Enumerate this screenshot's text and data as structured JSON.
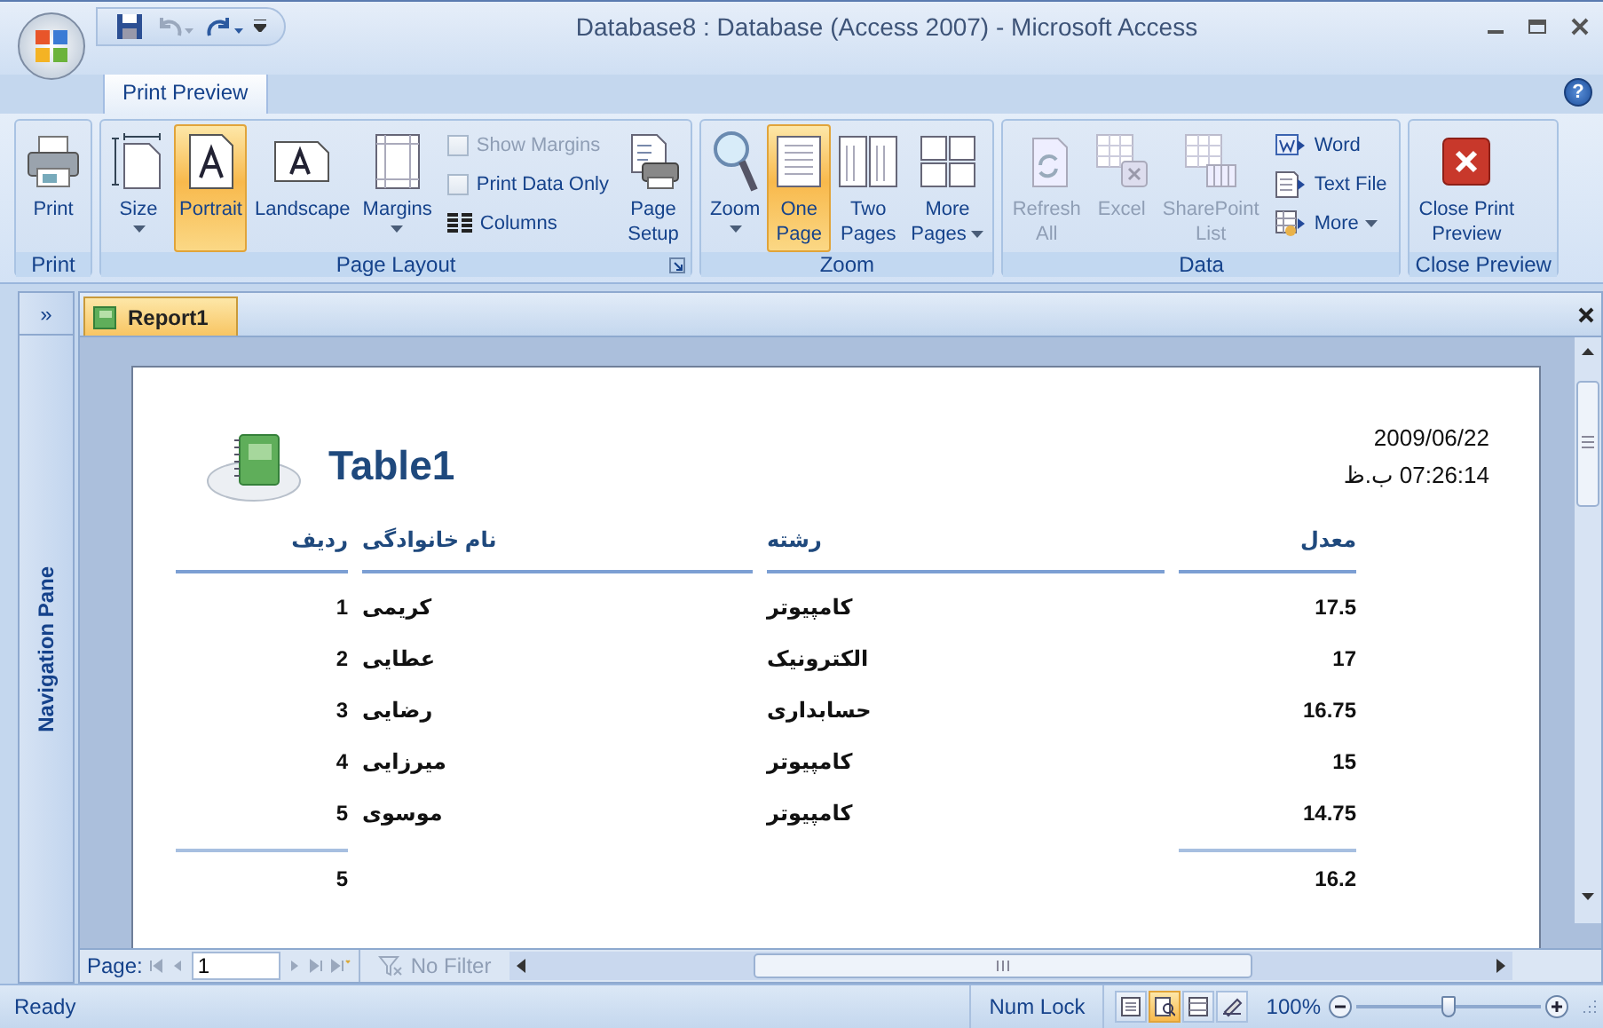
{
  "window": {
    "title": "Database8 : Database (Access 2007) - Microsoft Access"
  },
  "ribbon_tabs": [
    {
      "label": "Print Preview",
      "selected": true
    }
  ],
  "help_button": "?",
  "ribbon_groups": [
    {
      "label": "Print",
      "items": [
        {
          "kind": "large",
          "label": "Print",
          "selected": false,
          "disabled": false,
          "dropdown": false
        }
      ]
    },
    {
      "label": "Page Layout",
      "launcher": true,
      "items": [
        {
          "kind": "large",
          "label": "Size",
          "selected": false,
          "disabled": false,
          "dropdown": true
        },
        {
          "kind": "large",
          "label": "Portrait",
          "selected": true,
          "disabled": false,
          "dropdown": false
        },
        {
          "kind": "large",
          "label": "Landscape",
          "selected": false,
          "disabled": false,
          "dropdown": false
        },
        {
          "kind": "large",
          "label": "Margins",
          "selected": false,
          "disabled": false,
          "dropdown": true
        },
        {
          "kind": "checkbox",
          "label": "Show Margins",
          "checked": false,
          "selected": false,
          "disabled": true,
          "dropdown": false
        },
        {
          "kind": "checkbox",
          "label": "Print Data Only",
          "checked": false,
          "selected": false,
          "disabled": false,
          "dropdown": false
        },
        {
          "kind": "small",
          "label": "Columns",
          "selected": false,
          "disabled": false,
          "dropdown": false
        },
        {
          "kind": "large",
          "label": "Page\nSetup",
          "selected": false,
          "disabled": false,
          "dropdown": false
        }
      ]
    },
    {
      "label": "Zoom",
      "items": [
        {
          "kind": "large",
          "label": "Zoom",
          "selected": false,
          "disabled": false,
          "dropdown": true
        },
        {
          "kind": "large",
          "label": "One\nPage",
          "selected": true,
          "disabled": false,
          "dropdown": false
        },
        {
          "kind": "large",
          "label": "Two\nPages",
          "selected": false,
          "disabled": false,
          "dropdown": false
        },
        {
          "kind": "large",
          "label": "More\nPages",
          "selected": false,
          "disabled": false,
          "dropdown": true
        }
      ]
    },
    {
      "label": "Data",
      "items": [
        {
          "kind": "large",
          "label": "Refresh\nAll",
          "selected": false,
          "disabled": true,
          "dropdown": false
        },
        {
          "kind": "large",
          "label": "Excel",
          "selected": false,
          "disabled": true,
          "dropdown": false
        },
        {
          "kind": "large",
          "label": "SharePoint\nList",
          "selected": false,
          "disabled": true,
          "dropdown": false
        },
        {
          "kind": "small",
          "label": "Word",
          "selected": false,
          "disabled": false,
          "dropdown": false
        },
        {
          "kind": "small",
          "label": "Text File",
          "selected": false,
          "disabled": false,
          "dropdown": false
        },
        {
          "kind": "small",
          "label": "More",
          "selected": false,
          "disabled": false,
          "dropdown": true
        }
      ]
    },
    {
      "label": "Close Preview",
      "items": [
        {
          "kind": "large",
          "label": "Close Print\nPreview",
          "selected": false,
          "disabled": false,
          "dropdown": false
        }
      ]
    }
  ],
  "navigation_pane": {
    "toggle": "»",
    "label": "Navigation Pane"
  },
  "document_tabs": [
    {
      "label": "Report1",
      "selected": true
    }
  ],
  "report": {
    "title": "Table1",
    "date": "2009/06/22",
    "time": "07:26:14 ب.ظ",
    "columns": [
      "ردیف",
      "نام خانوادگی",
      "رشته",
      "معدل"
    ],
    "rows": [
      [
        "1",
        "کریمی",
        "کامپیوتر",
        "17.5"
      ],
      [
        "2",
        "عطایی",
        "الکترونیک",
        "17"
      ],
      [
        "3",
        "رضایی",
        "حسابداری",
        "16.75"
      ],
      [
        "4",
        "میرزایی",
        "کامپیوتر",
        "15"
      ],
      [
        "5",
        "موسوی",
        "کامپیوتر",
        "14.75"
      ]
    ],
    "totals": {
      "count": "5",
      "average": "16.2"
    }
  },
  "record_navigation": {
    "label": "Page:",
    "value": "1",
    "filter": "No Filter",
    "filter_disabled": true
  },
  "status_bar": {
    "status": "Ready",
    "num_lock": "Num Lock",
    "views": [
      {
        "selected": false
      },
      {
        "selected": true
      },
      {
        "selected": false
      },
      {
        "selected": false
      }
    ],
    "zoom": "100%",
    "zoom_slider": {
      "level": 0.5
    }
  }
}
